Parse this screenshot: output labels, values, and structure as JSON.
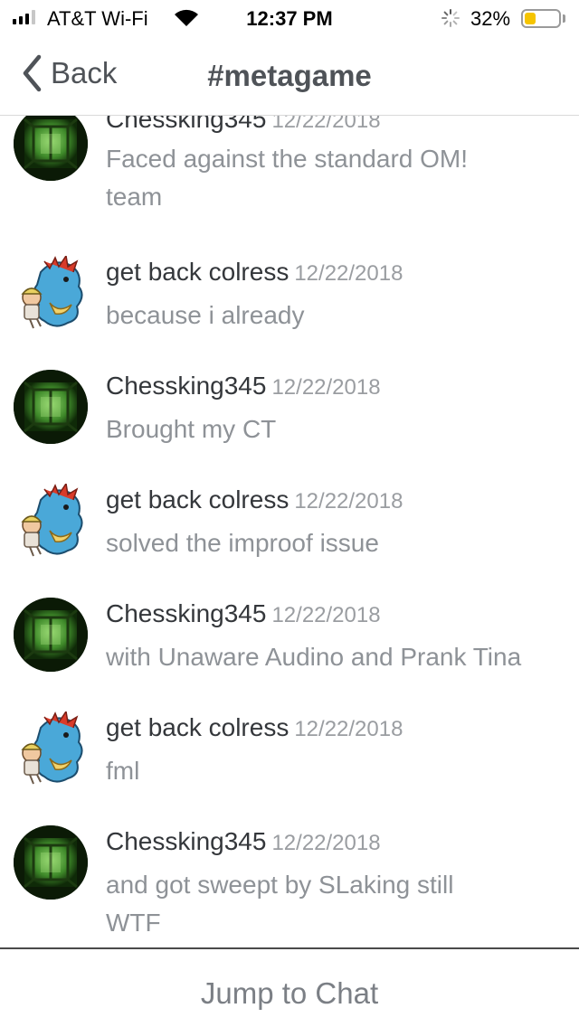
{
  "status_bar": {
    "carrier": "AT&T Wi-Fi",
    "time": "12:37 PM",
    "battery_percent_label": "32%",
    "battery_level": 0.32,
    "icons": [
      "signal-icon",
      "wifi-icon",
      "activity-spinner-icon",
      "battery-icon"
    ]
  },
  "nav": {
    "back_label": "Back",
    "title": "#metagame",
    "back_icon": "chevron-left-icon"
  },
  "messages": [
    {
      "author": "Chessking345",
      "timestamp": "12/22/2018",
      "lines": [
        "Faced against the standard OM!",
        "team"
      ]
    },
    {
      "author": "get back colress",
      "timestamp": "12/22/2018",
      "lines": [
        "because i already"
      ]
    },
    {
      "author": "Chessking345",
      "timestamp": "12/22/2018",
      "lines": [
        "Brought my CT"
      ]
    },
    {
      "author": "get back colress",
      "timestamp": "12/22/2018",
      "lines": [
        "solved the improof issue"
      ]
    },
    {
      "author": "Chessking345",
      "timestamp": "12/22/2018",
      "lines": [
        "with Unaware Audino and Prank Tina"
      ]
    },
    {
      "author": "get back colress",
      "timestamp": "12/22/2018",
      "lines": [
        "fml"
      ]
    },
    {
      "author": "Chessking345",
      "timestamp": "12/22/2018",
      "lines": [
        "and got sweept by SLaking still",
        "WTF"
      ]
    }
  ],
  "footer": {
    "jump_label": "Jump to Chat"
  },
  "colors": {
    "author": "#34373b",
    "message_text": "#8e9297",
    "timestamp": "#9a9da1",
    "battery": "#f5c400"
  }
}
